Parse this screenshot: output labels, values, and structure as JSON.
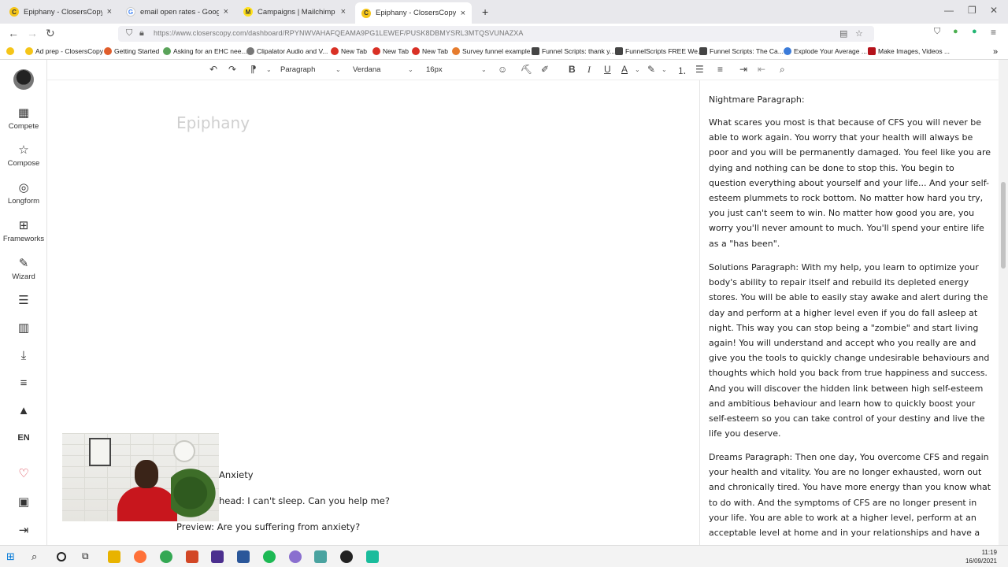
{
  "browser": {
    "tabs": [
      {
        "title": "Epiphany - ClosersCopy",
        "color": "#f5c518",
        "glyph": "C",
        "active": false
      },
      {
        "title": "email open rates - Google Search",
        "color": "#ffffff",
        "glyph": "G",
        "active": false
      },
      {
        "title": "Campaigns | Mailchimp",
        "color": "#ffe01b",
        "glyph": "M",
        "active": false
      },
      {
        "title": "Epiphany - ClosersCopy",
        "color": "#f5c518",
        "glyph": "C",
        "active": true
      }
    ],
    "new_tab": "+",
    "url": "https://www.closerscopy.com/dashboard/RPYNWVAHAFQEAMA9PG1LEWEF/PUSK8DBMYSRL3MTQSVUNAZXA"
  },
  "bookmarks": [
    {
      "label": "Ad prep - ClosersCopy",
      "color": "#f5c518"
    },
    {
      "label": "Getting Started",
      "color": "#e05d2b"
    },
    {
      "label": "Asking for an EHC nee...",
      "color": "#5aa35a"
    },
    {
      "label": "Clipalator Audio and V...",
      "color": "#777777"
    },
    {
      "label": "New Tab",
      "color": "#d93025"
    },
    {
      "label": "New Tab",
      "color": "#d93025"
    },
    {
      "label": "New Tab",
      "color": "#d93025"
    },
    {
      "label": "Survey funnel example",
      "color": "#e67c2e"
    },
    {
      "label": "Funnel Scripts: thank y...",
      "color": "#444444"
    },
    {
      "label": "FunnelScripts FREE We...",
      "color": "#444444"
    },
    {
      "label": "Funnel Scripts: The Ca...",
      "color": "#444444"
    },
    {
      "label": "Explode Your Average ...",
      "color": "#3b7bd9"
    },
    {
      "label": "Make Images, Videos ...",
      "color": "#b5121b"
    }
  ],
  "sidebar": {
    "items": [
      {
        "label": "Compete",
        "icon": "grid-icon",
        "glyph": "▦"
      },
      {
        "label": "Compose",
        "icon": "star-icon",
        "glyph": "☆"
      },
      {
        "label": "Longform",
        "icon": "target-icon",
        "glyph": "◎"
      },
      {
        "label": "Frameworks",
        "icon": "frameworks-icon",
        "glyph": "⊞"
      },
      {
        "label": "Wizard",
        "icon": "wand-icon",
        "glyph": "✎"
      },
      {
        "label": "",
        "icon": "database-icon",
        "glyph": "☰"
      },
      {
        "label": "",
        "icon": "bar-chart-icon",
        "glyph": "▥"
      },
      {
        "label": "",
        "icon": "download-icon",
        "glyph": "⤓"
      },
      {
        "label": "",
        "icon": "sliders-icon",
        "glyph": "≡"
      },
      {
        "label": "",
        "icon": "graduation-cap-icon",
        "glyph": "▲"
      },
      {
        "label": "EN",
        "icon": "language-icon",
        "glyph": ""
      },
      {
        "label": "",
        "icon": "heart-icon",
        "glyph": "♡"
      },
      {
        "label": "",
        "icon": "save-icon",
        "glyph": "▣"
      },
      {
        "label": "",
        "icon": "logout-icon",
        "glyph": "⇥"
      }
    ]
  },
  "toolbar": {
    "block_format": "Paragraph",
    "font_family": "Verdana",
    "font_size": "16px"
  },
  "editor": {
    "title_placeholder": "Epiphany",
    "lines": [
      "Anxiety",
      "head: I can't sleep. Can you help me?",
      "Preview: Are you suffering from anxiety?"
    ]
  },
  "panel": {
    "paragraphs": [
      "Nightmare Paragraph:",
      "What scares you most is that because of CFS you will never be able to work again. You worry that your health will always be poor and you will be permanently damaged. You feel like you are dying and nothing can be done to stop this. You begin to question everything about yourself and your life... And your self-esteem plummets to rock bottom. No matter how hard you try, you just can't seem to win. No matter how good you are, you worry you'll never amount to much. You'll spend your entire life as a \"has been\".",
      "Solutions Paragraph: With my help, you learn to optimize your body's ability to repair itself and rebuild its depleted energy stores. You will be able to easily stay awake and alert during the day and perform at a higher level even if you do fall asleep at night. This way you can stop being a \"zombie\" and start living again! You will understand and accept who you really are and give you the tools to quickly change undesirable behaviours and thoughts which hold you back from true happiness and success. And you will discover the hidden link between high self-esteem and ambitious behaviour and learn how to quickly boost your self-esteem so you can take control of your destiny and live the life you deserve.",
      "Dreams Paragraph: Then one day, You overcome CFS and regain your health and vitality. You are no longer exhausted, worn out and chronically tired. You have more energy than you know what to do with. And the symptoms of CFS are no longer present in your life. You are able to work at a higher level, perform at an acceptable level at home and in your relationships and have a"
    ]
  },
  "taskbar": {
    "time": "11:19",
    "date": "16/09/2021"
  }
}
